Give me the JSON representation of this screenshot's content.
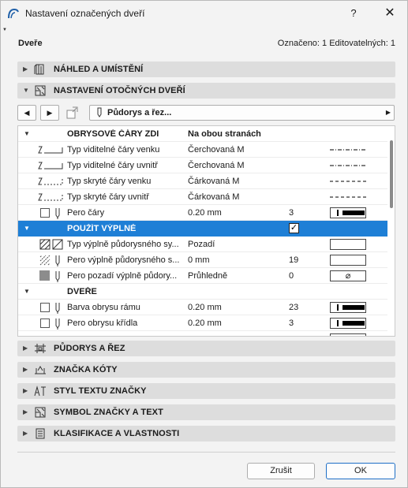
{
  "window": {
    "title": "Nastavení označených dveří",
    "help_label": "?",
    "close_label": "✕"
  },
  "header": {
    "left": "Dveře",
    "right": "Označeno: 1 Editovatelných: 1"
  },
  "sections_top": [
    {
      "label": "NÁHLED A UMÍSTĚNÍ",
      "icon": "door-preview-icon",
      "expanded": false
    },
    {
      "label": "NASTAVENÍ OTOČNÝCH DVEŘÍ",
      "icon": "door-settings-icon",
      "expanded": true
    }
  ],
  "toolbar": {
    "prev_label": "◀",
    "next_label": "▶",
    "dropdown_label": "Půdorys a řez...",
    "dropdown_arrow": "▶"
  },
  "table": {
    "rows": [
      {
        "type": "group",
        "name": "OBRYSOVÉ ČÁRY ZDI",
        "value": "Na obou stranách",
        "num": "",
        "preview": ""
      },
      {
        "type": "line",
        "name": "Typ viditelné čáry venku",
        "value": "Čerchovaná M",
        "num": "",
        "preview": "dashdot"
      },
      {
        "type": "line",
        "name": "Typ viditelné čáry uvnitř",
        "value": "Čerchovaná M",
        "num": "",
        "preview": "dashdot"
      },
      {
        "type": "line",
        "name": "Typ skryté čáry venku",
        "value": "Čárkovaná M",
        "num": "",
        "preview": "dash"
      },
      {
        "type": "line",
        "name": "Typ skryté čáry uvnitř",
        "value": "Čárkovaná M",
        "num": "",
        "preview": "dash"
      },
      {
        "type": "pen",
        "name": "Pero čáry",
        "value": "0.20 mm",
        "num": "3",
        "preview": "pen"
      },
      {
        "type": "group-hl",
        "name": "POUŽÍT VÝPLNĚ",
        "value": "",
        "num": "",
        "preview": "",
        "checked": true
      },
      {
        "type": "fill",
        "name": "Typ výplně půdorysného sy...",
        "value": "Pozadí",
        "num": "",
        "preview": "empty"
      },
      {
        "type": "fillpen",
        "name": "Pero výplně půdorysného s...",
        "value": "0 mm",
        "num": "19",
        "preview": "empty"
      },
      {
        "type": "bgpen",
        "name": "Pero pozadí výplně půdory...",
        "value": "Průhledně",
        "num": "0",
        "preview": "transparent"
      },
      {
        "type": "group",
        "name": "DVEŘE",
        "value": "",
        "num": "",
        "preview": ""
      },
      {
        "type": "pen",
        "name": "Barva obrysu rámu",
        "value": "0.20 mm",
        "num": "23",
        "preview": "pen"
      },
      {
        "type": "pen",
        "name": "Pero obrysu křídla",
        "value": "0.20 mm",
        "num": "3",
        "preview": "pen"
      }
    ],
    "transparent_symbol": "⌀",
    "check_symbol": "✓"
  },
  "sections_bottom": [
    {
      "label": "PŮDORYS A ŘEZ",
      "icon": "floor-plan-icon"
    },
    {
      "label": "ZNAČKA KÓTY",
      "icon": "dimension-marker-icon"
    },
    {
      "label": "STYL TEXTU ZNAČKY",
      "icon": "text-style-icon"
    },
    {
      "label": "SYMBOL ZNAČKY A TEXT",
      "icon": "marker-symbol-icon"
    },
    {
      "label": "KLASIFIKACE A VLASTNOSTI",
      "icon": "classification-icon"
    }
  ],
  "footer": {
    "cancel_label": "Zrušit",
    "ok_label": "OK"
  },
  "colors": {
    "accent": "#1e7fd6",
    "section_bg": "#dddddd",
    "window_bg": "#f3f3f3"
  }
}
